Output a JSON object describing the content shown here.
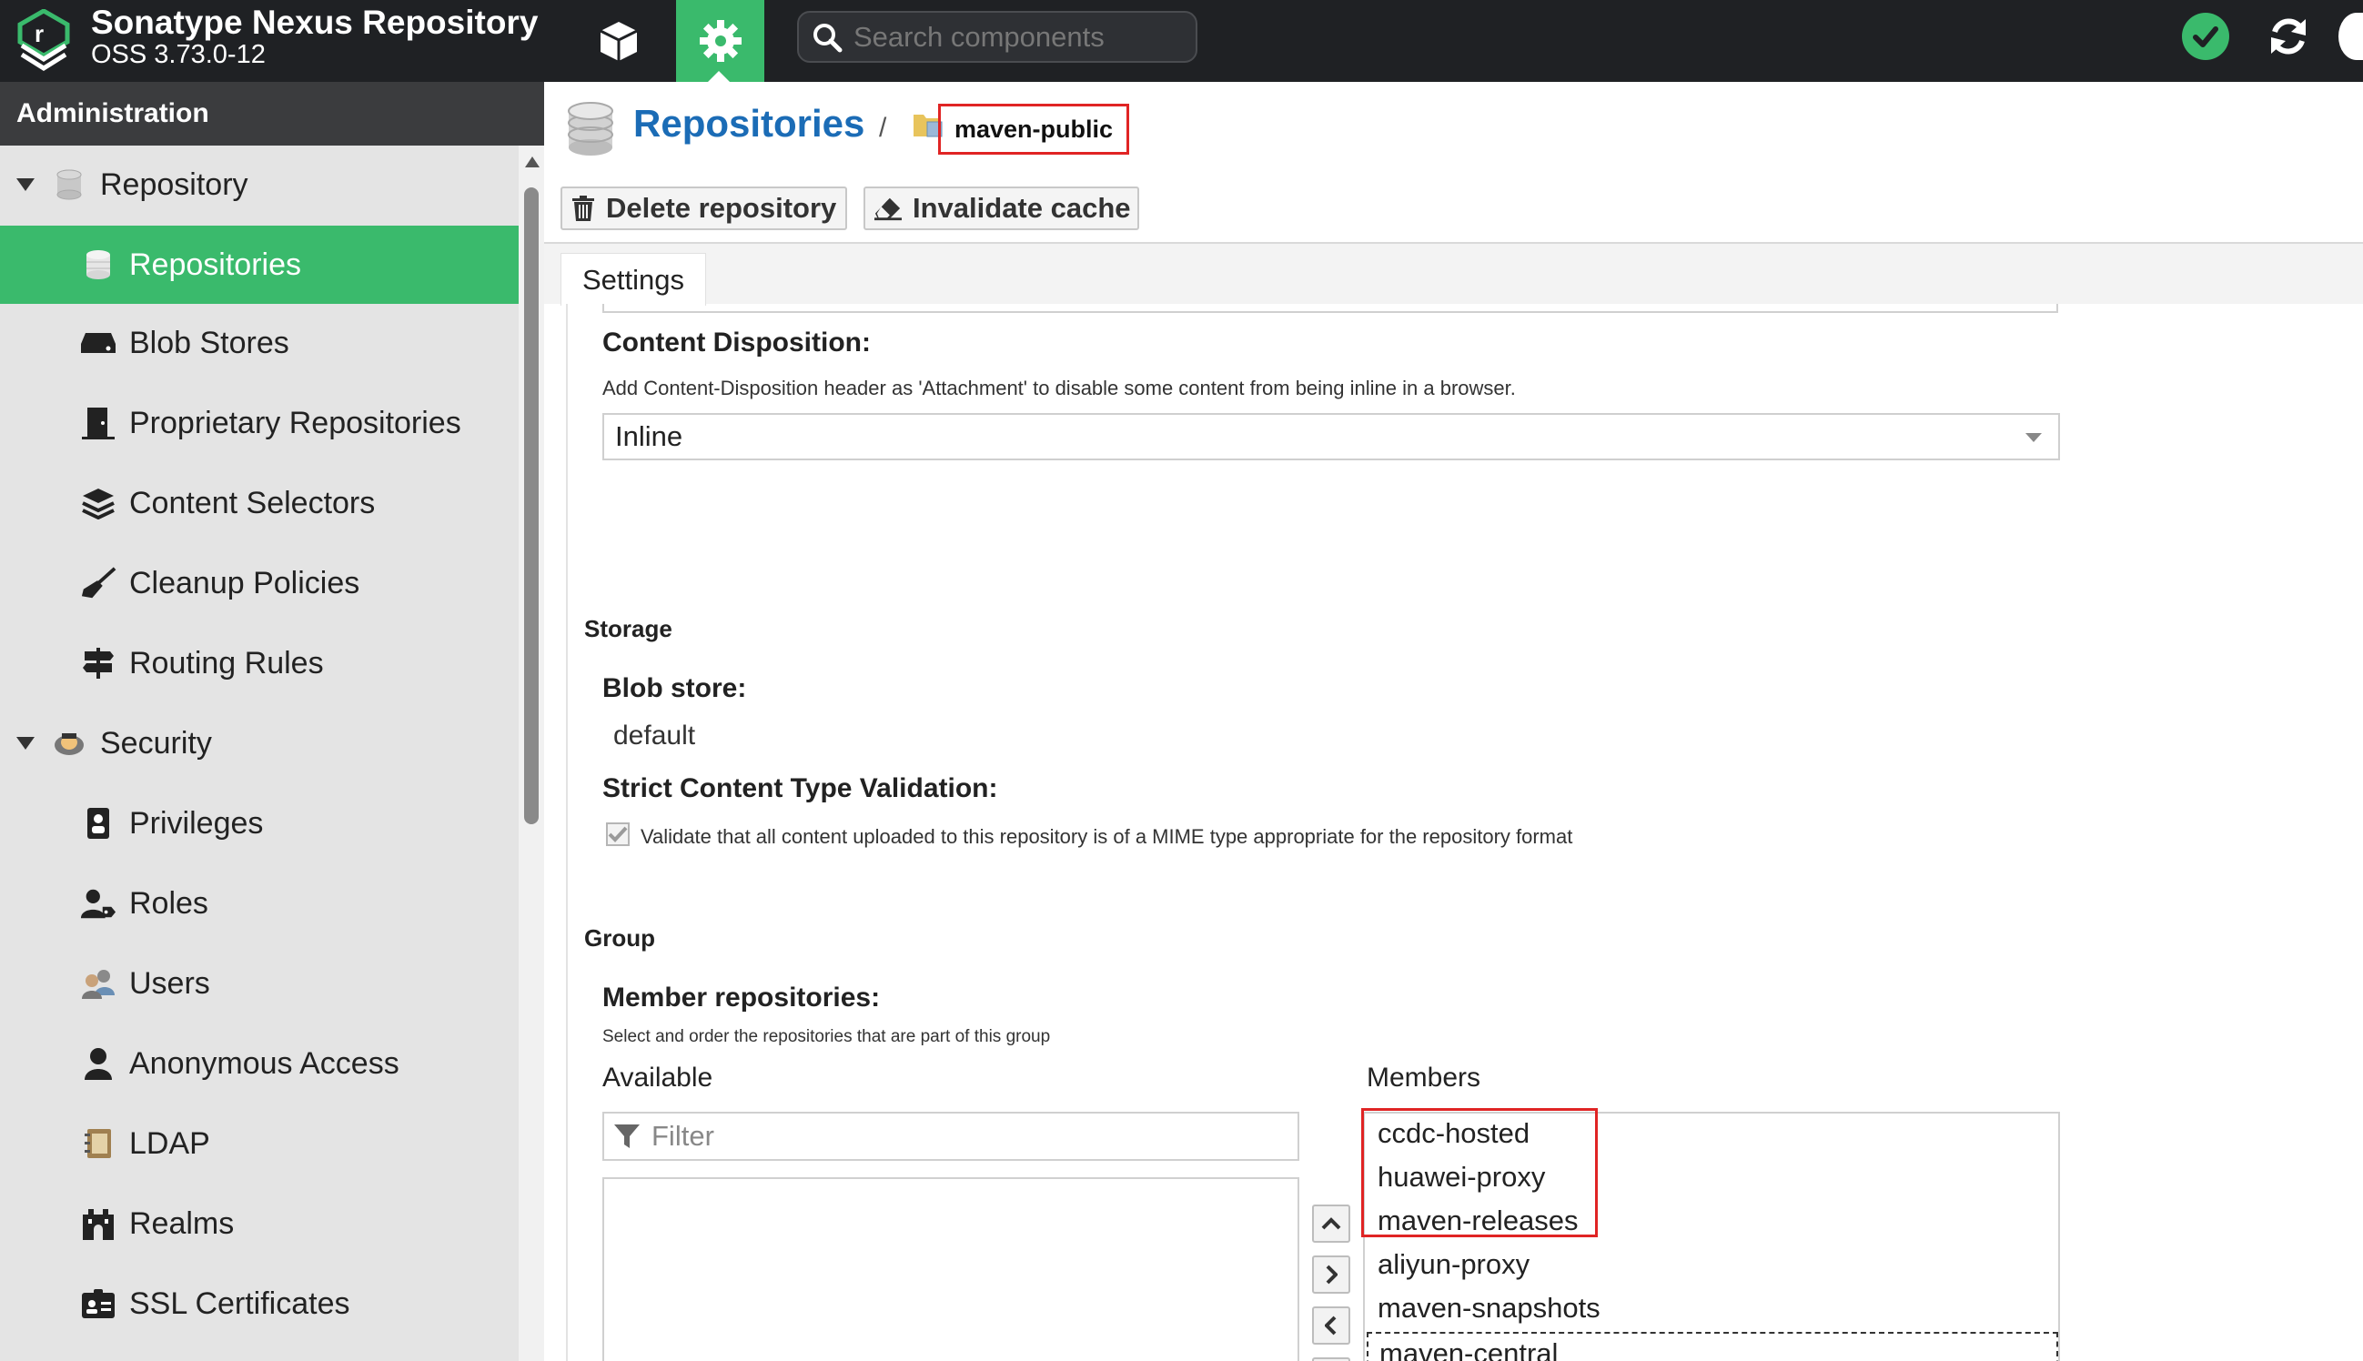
{
  "header": {
    "title": "Sonatype Nexus Repository",
    "version": "OSS 3.73.0-12",
    "search_placeholder": "Search components",
    "icons": {
      "logo": "nexus-logo-icon",
      "browse": "cube-icon",
      "admin": "gear-icon",
      "search": "search-icon",
      "status": "check-circle-icon",
      "refresh": "refresh-icon"
    },
    "admin_color": "#3aba6c"
  },
  "sidebar": {
    "title": "Administration",
    "items": [
      {
        "label": "Repository",
        "type": "group",
        "icon": "database-icon"
      },
      {
        "label": "Repositories",
        "type": "child",
        "active": true,
        "icon": "database-icon"
      },
      {
        "label": "Blob Stores",
        "type": "child",
        "icon": "hard-drive-icon"
      },
      {
        "label": "Proprietary Repositories",
        "type": "child",
        "icon": "door-icon"
      },
      {
        "label": "Content Selectors",
        "type": "child",
        "icon": "layers-icon"
      },
      {
        "label": "Cleanup Policies",
        "type": "child",
        "icon": "broom-icon"
      },
      {
        "label": "Routing Rules",
        "type": "child",
        "icon": "signpost-icon"
      },
      {
        "label": "Security",
        "type": "group",
        "icon": "security-badge-icon"
      },
      {
        "label": "Privileges",
        "type": "child",
        "icon": "id-badge-icon"
      },
      {
        "label": "Roles",
        "type": "child",
        "icon": "user-tag-icon"
      },
      {
        "label": "Users",
        "type": "child",
        "icon": "users-icon"
      },
      {
        "label": "Anonymous Access",
        "type": "child",
        "icon": "user-icon"
      },
      {
        "label": "LDAP",
        "type": "child",
        "icon": "address-book-icon"
      },
      {
        "label": "Realms",
        "type": "child",
        "icon": "castle-icon"
      },
      {
        "label": "SSL Certificates",
        "type": "child",
        "icon": "certificate-icon"
      }
    ]
  },
  "breadcrumb": {
    "section": "Repositories",
    "separator": "/",
    "current": "maven-public"
  },
  "toolbar": {
    "delete_label": "Delete repository",
    "invalidate_label": "Invalidate cache"
  },
  "tabs": [
    {
      "label": "Settings",
      "active": true
    }
  ],
  "form": {
    "content_disposition": {
      "label": "Content Disposition:",
      "help": "Add Content-Disposition header as 'Attachment' to disable some content from being inline in a browser.",
      "value": "Inline"
    },
    "storage": {
      "section": "Storage",
      "blob_store_label": "Blob store:",
      "blob_store_value": "default",
      "strict_label": "Strict Content Type Validation:",
      "strict_checked": true,
      "strict_help": "Validate that all content uploaded to this repository is of a MIME type appropriate for the repository format"
    },
    "group": {
      "section": "Group",
      "members_label": "Member repositories:",
      "members_help": "Select and order the repositories that are part of this group",
      "available_label": "Available",
      "members_col_label": "Members",
      "filter_placeholder": "Filter",
      "available": [],
      "members": [
        "ccdc-hosted",
        "huawei-proxy",
        "maven-releases",
        "aliyun-proxy",
        "maven-snapshots",
        "maven-central"
      ],
      "focused_member": "maven-central"
    }
  },
  "colors": {
    "accent": "#3aba6c",
    "link": "#1b6cb6",
    "annotation": "#e02424",
    "header_bg": "#1f2124"
  }
}
